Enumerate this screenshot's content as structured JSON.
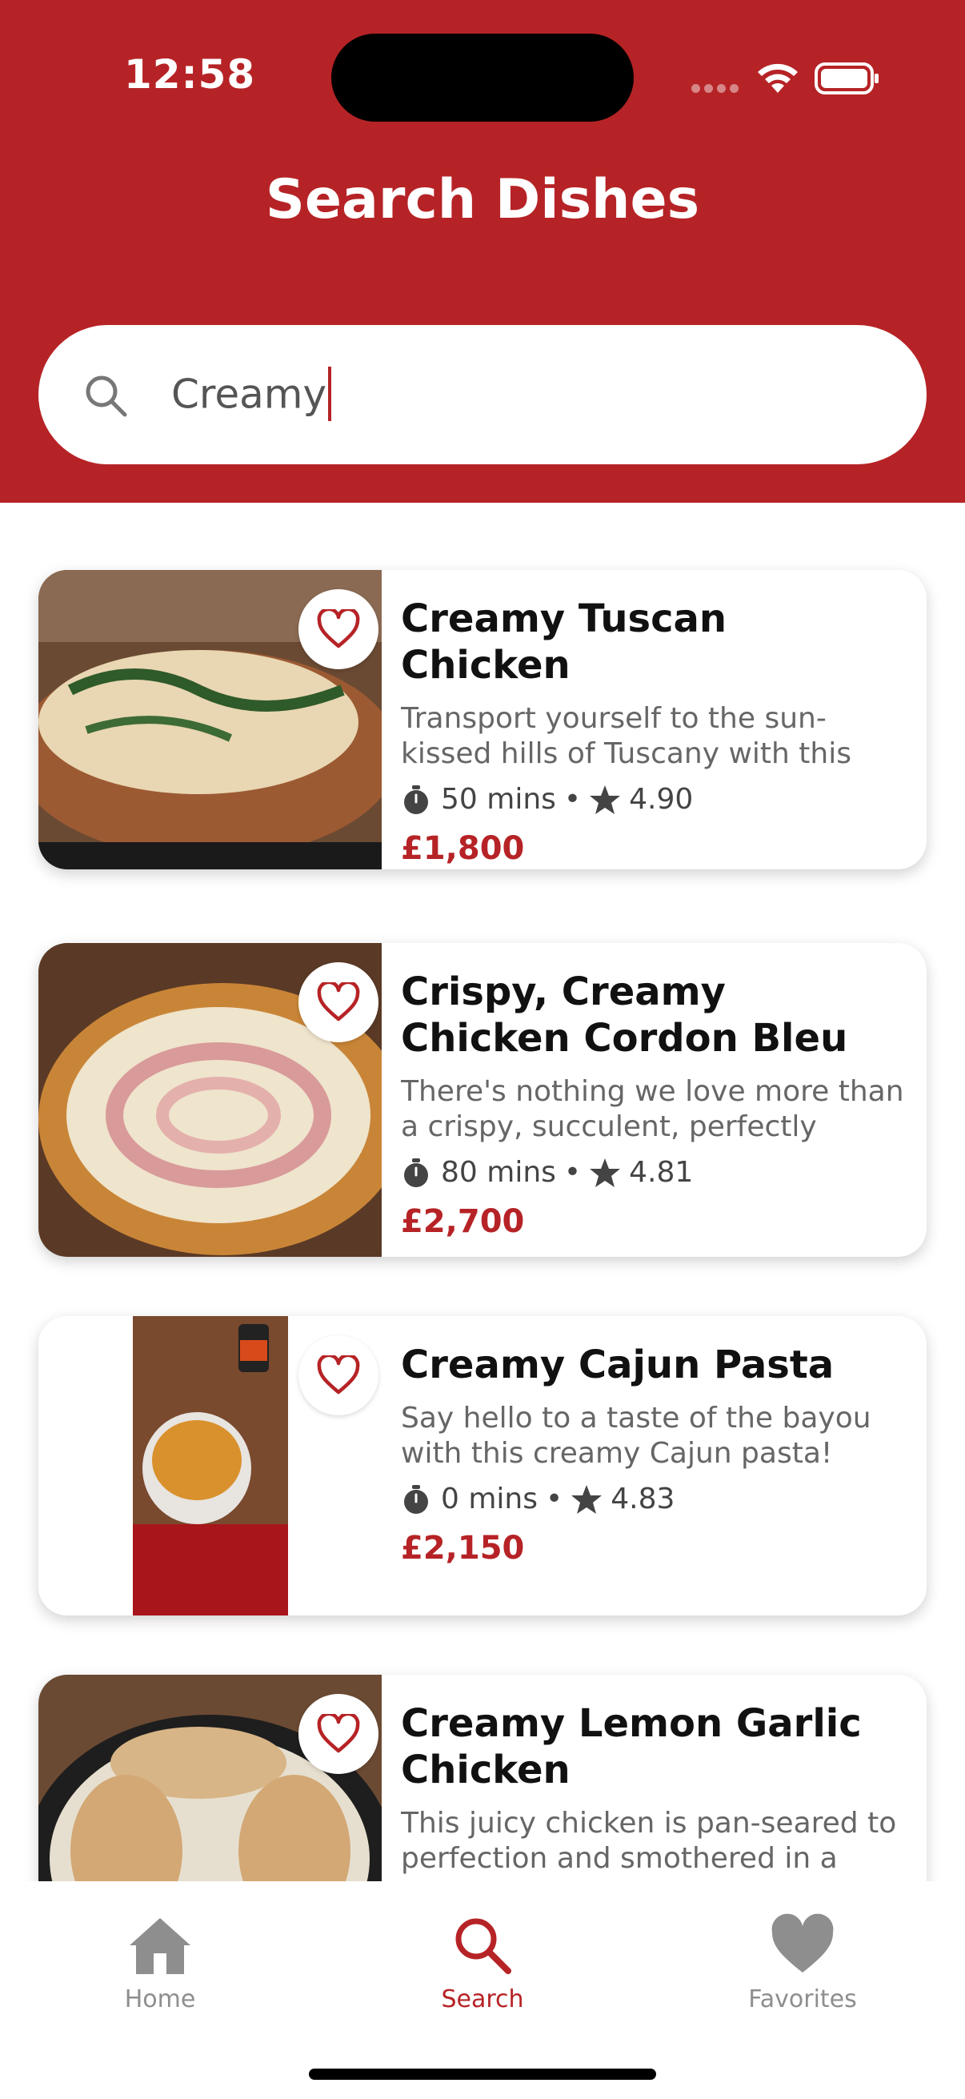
{
  "status_bar": {
    "time": "12:58"
  },
  "header": {
    "title": "Search Dishes"
  },
  "search": {
    "value": "Creamy"
  },
  "results": [
    {
      "title": "Creamy Tuscan Chicken",
      "description": "Transport yourself to the sun-kissed hills of Tuscany with this e...",
      "time": "50 mins",
      "rating": "4.90",
      "price": "£1,800"
    },
    {
      "title": "Crispy, Creamy Chicken Cordon Bleu",
      "description": "There's nothing we love more than a crispy, succulent, perfectly fried...",
      "time": "80 mins",
      "rating": "4.81",
      "price": "£2,700"
    },
    {
      "title": "Creamy Cajun Pasta",
      "description": "Say hello to a taste of the bayou with this creamy Cajun pasta! Sav...",
      "time": "0 mins",
      "rating": "4.83",
      "price": "£2,150"
    },
    {
      "title": "Creamy Lemon Garlic Chicken",
      "description": "This juicy chicken is pan-seared to perfection and smothered in a ric...",
      "time": "",
      "rating": "",
      "price": ""
    }
  ],
  "meta_separator": "•",
  "tabs": [
    {
      "label": "Home",
      "icon": "home-icon",
      "active": false
    },
    {
      "label": "Search",
      "icon": "search-icon",
      "active": true
    },
    {
      "label": "Favorites",
      "icon": "heart-icon",
      "active": false
    }
  ],
  "colors": {
    "brand": "#B62326",
    "inactive_tab": "#8E8E8E",
    "text_primary": "#111111",
    "text_secondary": "#666666"
  }
}
